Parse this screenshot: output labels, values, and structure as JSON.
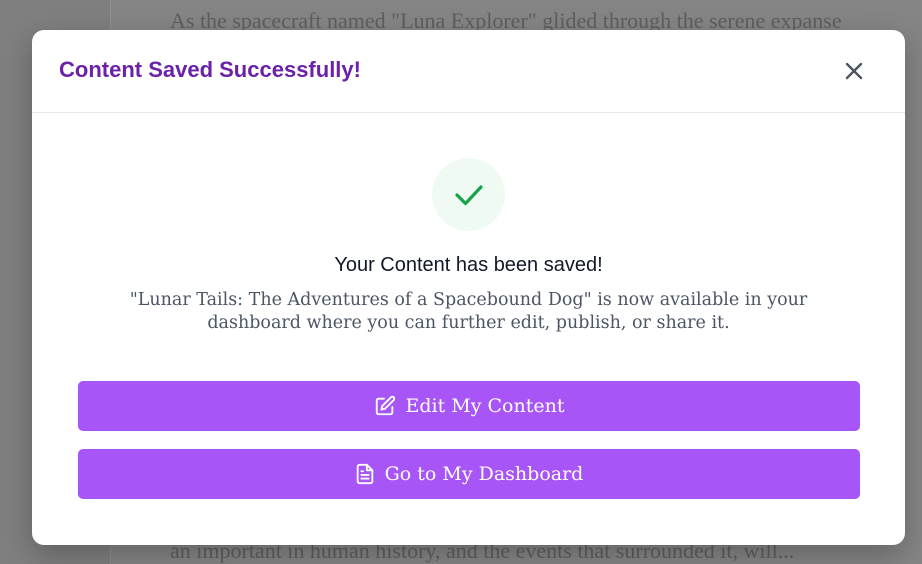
{
  "background": {
    "text_lines": [
      "As the spacecraft named \"Luna Explorer\" glided through the serene expanse",
      "an important in human history, and the events that surrounded it, will..."
    ]
  },
  "modal": {
    "title": "Content Saved Successfully!",
    "close_icon": "close-icon",
    "status_icon": "checkmark-icon",
    "heading": "Your Content has been saved!",
    "description": "\"Lunar Tails: The Adventures of a Spacebound Dog\" is now available in your dashboard where you can further edit, publish, or share it.",
    "buttons": {
      "edit_label": "Edit My Content",
      "edit_icon": "edit-icon",
      "dashboard_label": "Go to My Dashboard",
      "dashboard_icon": "document-icon"
    }
  },
  "colors": {
    "title": "#6b21a8",
    "button": "#a855f7",
    "check": "#16a34a",
    "check_bg": "#effaf2"
  }
}
